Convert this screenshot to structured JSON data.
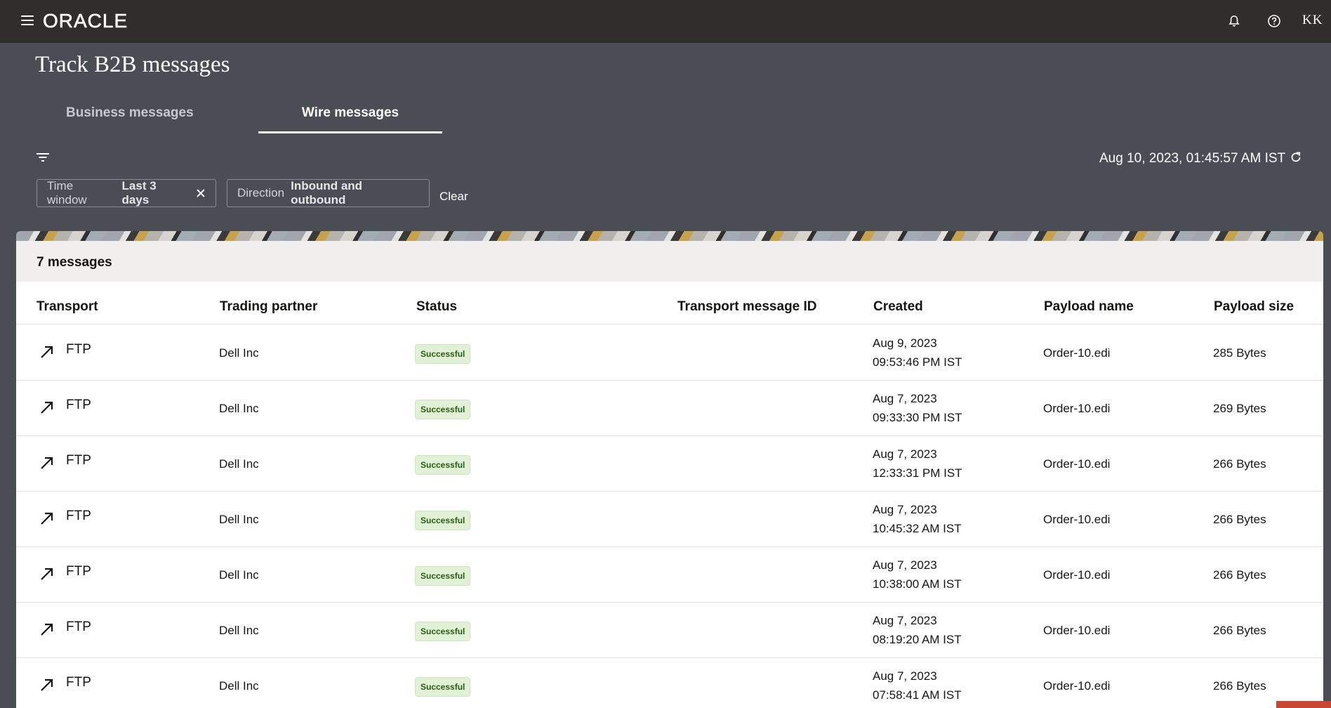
{
  "app": {
    "logo": "ORACLE",
    "avatar_initials": "KK"
  },
  "page": {
    "title": "Track B2B messages"
  },
  "tabs": [
    {
      "label": "Business messages"
    },
    {
      "label": "Wire messages"
    }
  ],
  "timestamp": "Aug 10, 2023, 01:45:57 AM IST",
  "filters": {
    "time_window": {
      "key": "Time window",
      "value": "Last 3 days"
    },
    "direction": {
      "key": "Direction",
      "value": "Inbound and outbound"
    },
    "clear_label": "Clear"
  },
  "results": {
    "count_label": "7 messages"
  },
  "columns": [
    "Transport",
    "Trading partner",
    "Status",
    "Transport message ID",
    "Created",
    "Payload name",
    "Payload size"
  ],
  "rows": [
    {
      "transport": "FTP",
      "partner": "Dell Inc",
      "status": "Successful",
      "message_id": "",
      "created_date": "Aug 9, 2023",
      "created_time": "09:53:46 PM IST",
      "payload_name": "Order-10.edi",
      "payload_size": "285 Bytes"
    },
    {
      "transport": "FTP",
      "partner": "Dell Inc",
      "status": "Successful",
      "message_id": "",
      "created_date": "Aug 7, 2023",
      "created_time": "09:33:30 PM IST",
      "payload_name": "Order-10.edi",
      "payload_size": "269 Bytes"
    },
    {
      "transport": "FTP",
      "partner": "Dell Inc",
      "status": "Successful",
      "message_id": "",
      "created_date": "Aug 7, 2023",
      "created_time": "12:33:31 PM IST",
      "payload_name": "Order-10.edi",
      "payload_size": "266 Bytes"
    },
    {
      "transport": "FTP",
      "partner": "Dell Inc",
      "status": "Successful",
      "message_id": "",
      "created_date": "Aug 7, 2023",
      "created_time": "10:45:32 AM IST",
      "payload_name": "Order-10.edi",
      "payload_size": "266 Bytes"
    },
    {
      "transport": "FTP",
      "partner": "Dell Inc",
      "status": "Successful",
      "message_id": "",
      "created_date": "Aug 7, 2023",
      "created_time": "10:38:00 AM IST",
      "payload_name": "Order-10.edi",
      "payload_size": "266 Bytes"
    },
    {
      "transport": "FTP",
      "partner": "Dell Inc",
      "status": "Successful",
      "message_id": "",
      "created_date": "Aug 7, 2023",
      "created_time": "08:19:20 AM IST",
      "payload_name": "Order-10.edi",
      "payload_size": "266 Bytes"
    },
    {
      "transport": "FTP",
      "partner": "Dell Inc",
      "status": "Successful",
      "message_id": "",
      "created_date": "Aug 7, 2023",
      "created_time": "07:58:41 AM IST",
      "payload_name": "Order-10.edi",
      "payload_size": "266 Bytes"
    }
  ],
  "icons": {
    "direction": "arrow-up-right-icon",
    "menu": "hamburger-icon",
    "notifications": "bell-icon",
    "help": "help-icon",
    "filter": "filter-icon",
    "refresh": "refresh-icon",
    "remove": "close-icon"
  },
  "colors": {
    "topbar": "#312d2a",
    "header": "#4a4d54",
    "success_bg": "#e1f1d6",
    "success_text": "#2b5b12",
    "accent": "#c74634"
  }
}
